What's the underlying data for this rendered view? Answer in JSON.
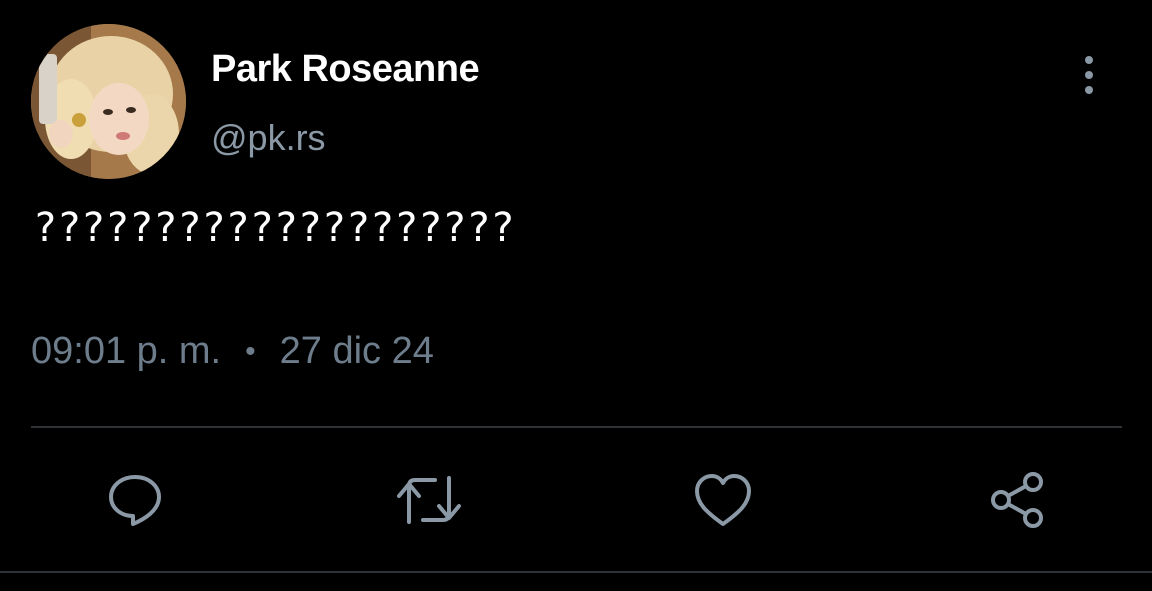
{
  "tweet": {
    "display_name": "Park Roseanne",
    "handle": "@pk.rs",
    "text": "????????????????????",
    "time": "09:01 p. m.",
    "separator": "•",
    "date": "27 dic 24"
  },
  "icons": {
    "more": "more-vertical-icon",
    "reply": "reply-icon",
    "retweet": "retweet-icon",
    "like": "heart-icon",
    "share": "share-icon"
  },
  "colors": {
    "background": "#000000",
    "primary_text": "#ffffff",
    "secondary_text": "#8b98a5",
    "meta_text": "#6e7d8c",
    "icon": "#8b98a5",
    "divider": "#2f3336"
  }
}
